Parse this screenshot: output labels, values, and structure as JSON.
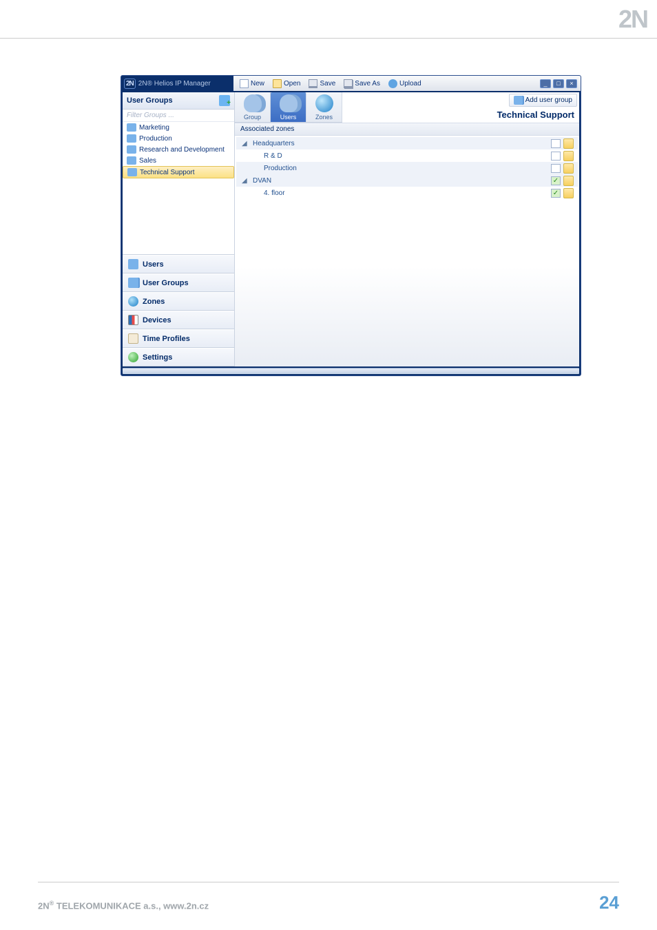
{
  "brand": "2N",
  "app_title": "2N® Helios IP Manager",
  "toolbar": {
    "new": "New",
    "open": "Open",
    "save": "Save",
    "saveas": "Save As",
    "upload": "Upload"
  },
  "sidebar": {
    "panel_title": "User Groups",
    "filter_placeholder": "Filter Groups ...",
    "groups": [
      {
        "label": "Marketing"
      },
      {
        "label": "Production"
      },
      {
        "label": "Research and Development"
      },
      {
        "label": "Sales"
      },
      {
        "label": "Technical Support"
      }
    ],
    "nav": {
      "users": "Users",
      "user_groups": "User Groups",
      "zones": "Zones",
      "devices": "Devices",
      "time_profiles": "Time Profiles",
      "settings": "Settings"
    }
  },
  "content": {
    "tabs": {
      "group": "Group",
      "users": "Users",
      "zones": "Zones"
    },
    "add_user_group": "Add user group",
    "selected_group": "Technical Support",
    "assoc_header": "Associated zones",
    "zones": [
      {
        "level": 0,
        "expandable": true,
        "name": "Headquarters",
        "checked": false
      },
      {
        "level": 1,
        "expandable": false,
        "name": "R & D",
        "checked": false
      },
      {
        "level": 1,
        "expandable": false,
        "name": "Production",
        "checked": false
      },
      {
        "level": 0,
        "expandable": true,
        "name": "DVAN",
        "checked": true
      },
      {
        "level": 1,
        "expandable": false,
        "name": "4. floor",
        "checked": true
      }
    ]
  },
  "footer": {
    "left": "2N® TELEKOMUNIKACE a.s., www.2n.cz",
    "page": "24"
  }
}
